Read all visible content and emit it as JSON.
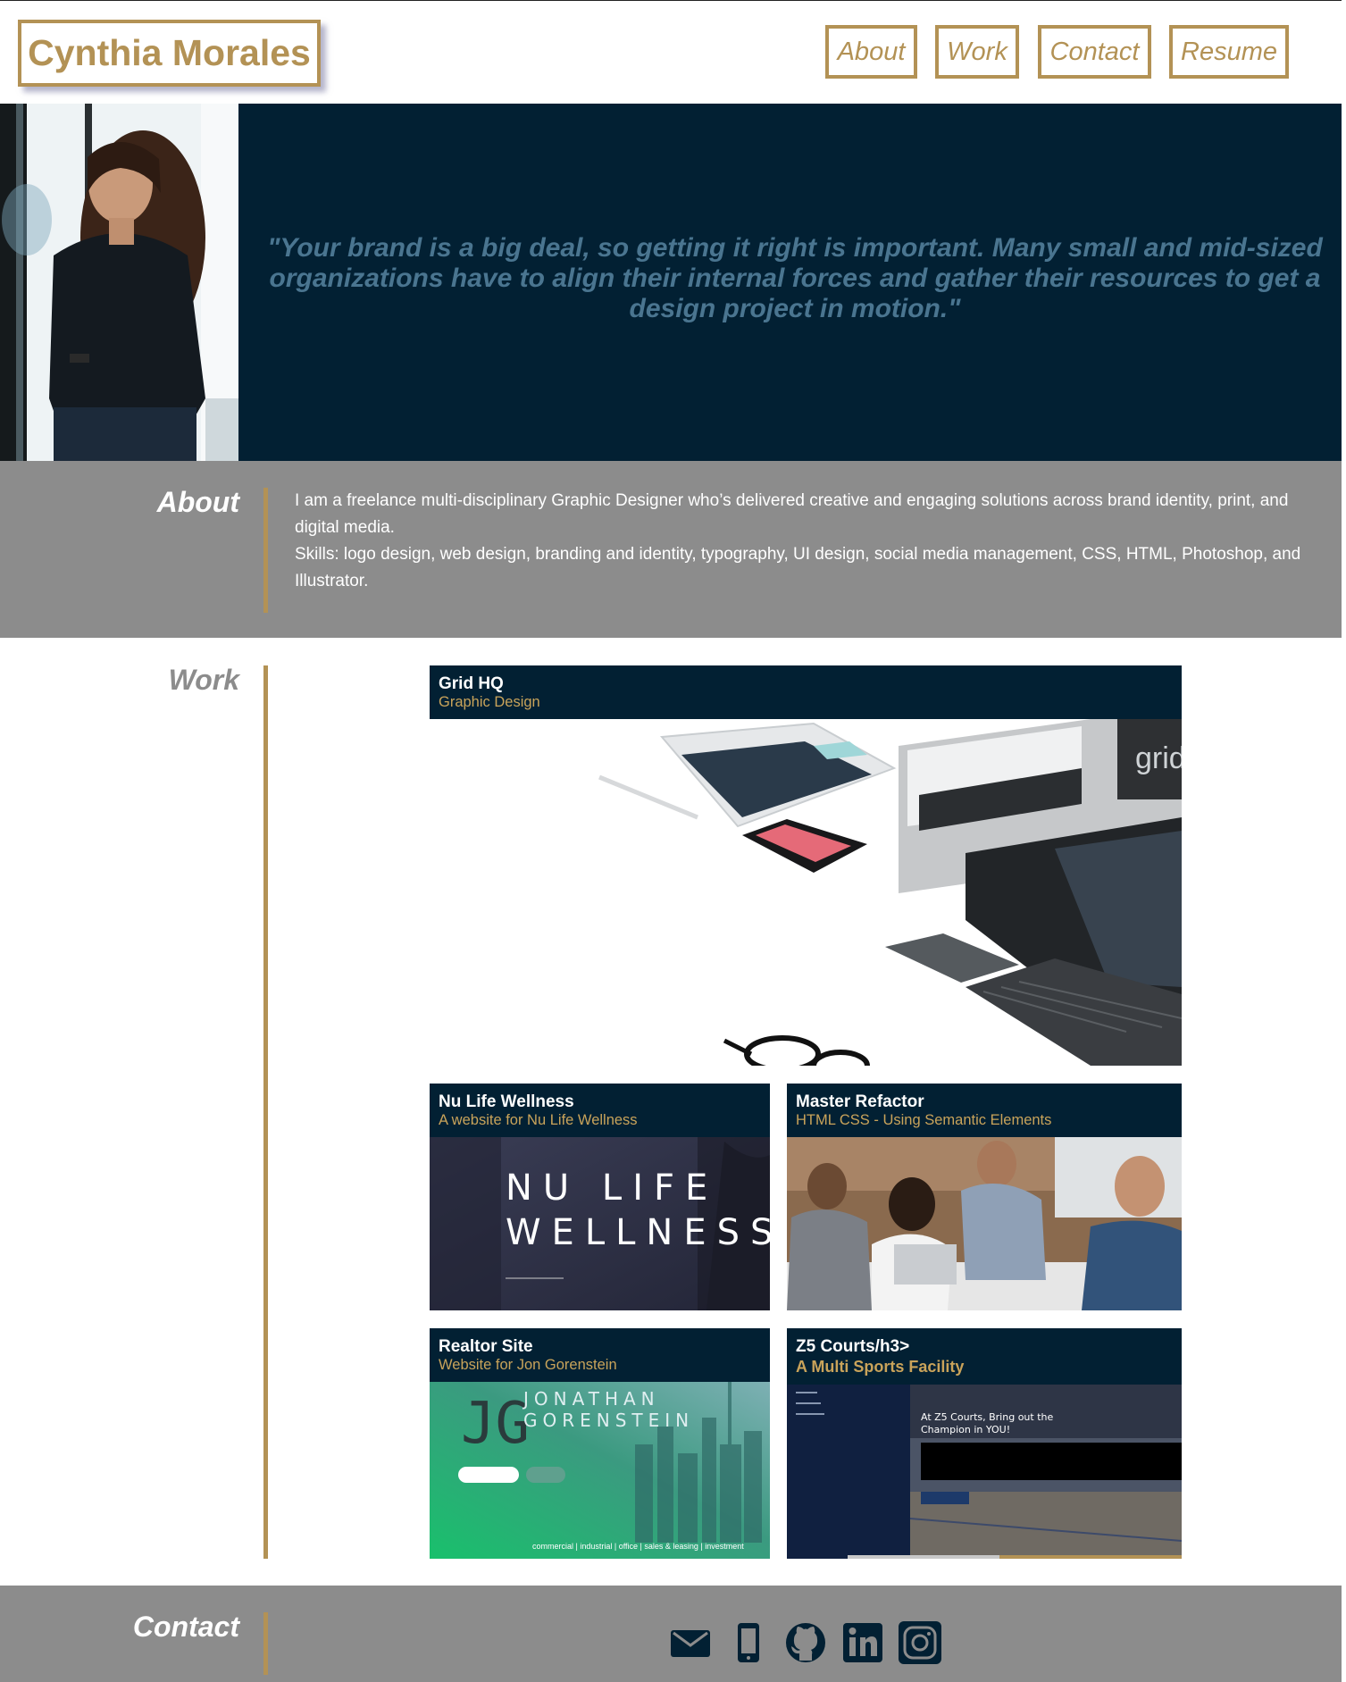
{
  "header": {
    "name": "Cynthia Morales",
    "nav": [
      {
        "label": "About"
      },
      {
        "label": "Work"
      },
      {
        "label": "Contact"
      },
      {
        "label": "Resume"
      }
    ]
  },
  "hero": {
    "quote": "\"Your brand is a big deal, so getting it right is important. Many small and mid-sized organizations have to align their internal forces and gather their resources to get a design project in motion.\""
  },
  "about": {
    "title": "About",
    "paragraph1": "I am a freelance multi-disciplinary Graphic Designer who’s delivered creative and engaging solutions across brand identity, print, and digital media.",
    "paragraph2": "Skills: logo design, web design, branding and identity, typography, UI design, social media management, CSS, HTML, Photoshop, and Illustrator."
  },
  "work": {
    "title": "Work",
    "projects": [
      {
        "title": "Grid HQ",
        "subtitle": "Graphic Design",
        "image_text": "grid"
      },
      {
        "title": "Nu Life Wellness",
        "subtitle": "A website for Nu Life Wellness",
        "image_text_1": "NU LIFE",
        "image_text_2": "WELLNESS"
      },
      {
        "title": "Master Refactor",
        "subtitle": "HTML CSS - Using Semantic Elements"
      },
      {
        "title": "Realtor Site",
        "subtitle": "Website for Jon Gorenstein",
        "image_text_1": "JONATHAN",
        "image_text_2": "GORENSTEIN",
        "image_text_3": "commercial | industrial | office | sales & leasing | investment"
      },
      {
        "title": "Z5 Courts/h3>",
        "subtitle": "A Multi Sports Facility",
        "image_text_1": "At Z5 Courts, Bring out the",
        "image_text_2": "Champion in YOU!"
      }
    ]
  },
  "contact": {
    "title": "Contact",
    "icons": [
      "mail-icon",
      "phone-icon",
      "github-icon",
      "linkedin-icon",
      "instagram-icon"
    ]
  },
  "colors": {
    "navy": "#022033",
    "gold": "#b39255",
    "gray": "#8c8c8c",
    "quote": "#4a7590"
  }
}
